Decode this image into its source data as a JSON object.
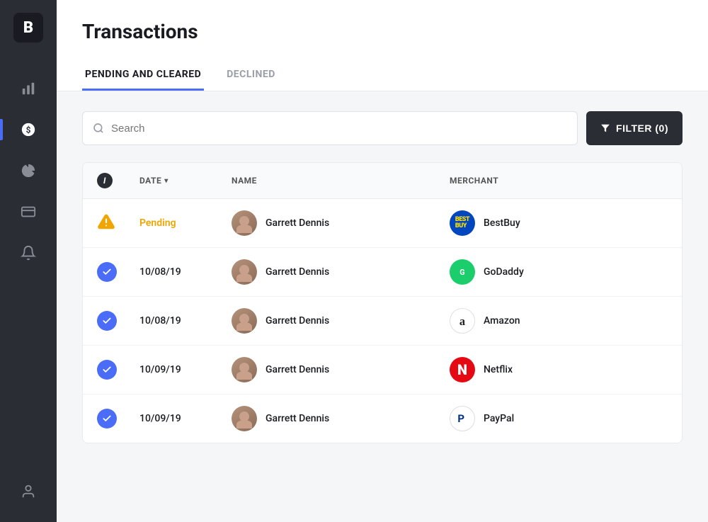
{
  "sidebar": {
    "logo": "B",
    "items": [
      {
        "id": "analytics",
        "icon": "chart-bar",
        "active": false
      },
      {
        "id": "transactions",
        "icon": "dollar-circle",
        "active": true
      },
      {
        "id": "pie-chart",
        "icon": "pie-chart",
        "active": false
      },
      {
        "id": "cards",
        "icon": "card",
        "active": false
      },
      {
        "id": "notifications",
        "icon": "bell",
        "active": false
      }
    ],
    "bottom_items": [
      {
        "id": "profile",
        "icon": "user",
        "active": false
      }
    ]
  },
  "page": {
    "title": "Transactions",
    "tabs": [
      {
        "id": "pending-cleared",
        "label": "PENDING AND CLEARED",
        "active": true
      },
      {
        "id": "declined",
        "label": "DECLINED",
        "active": false
      }
    ]
  },
  "search": {
    "placeholder": "Search",
    "value": ""
  },
  "filter_button": {
    "label": "FILTER (0)"
  },
  "table": {
    "headers": [
      {
        "id": "info",
        "label": ""
      },
      {
        "id": "date",
        "label": "DATE",
        "sortable": true
      },
      {
        "id": "name",
        "label": "NAME"
      },
      {
        "id": "merchant",
        "label": "MERCHANT"
      }
    ],
    "rows": [
      {
        "status": "pending",
        "status_icon": "warning",
        "date": "Pending",
        "name": "Garrett Dennis",
        "merchant_name": "BestBuy",
        "merchant_type": "bestbuy"
      },
      {
        "status": "cleared",
        "status_icon": "check",
        "date": "10/08/19",
        "name": "Garrett Dennis",
        "merchant_name": "GoDaddy",
        "merchant_type": "godaddy"
      },
      {
        "status": "cleared",
        "status_icon": "check",
        "date": "10/08/19",
        "name": "Garrett Dennis",
        "merchant_name": "Amazon",
        "merchant_type": "amazon"
      },
      {
        "status": "cleared",
        "status_icon": "check",
        "date": "10/09/19",
        "name": "Garrett Dennis",
        "merchant_name": "Netflix",
        "merchant_type": "netflix"
      },
      {
        "status": "cleared",
        "status_icon": "check",
        "date": "10/09/19",
        "name": "Garrett Dennis",
        "merchant_name": "PayPal",
        "merchant_type": "paypal"
      }
    ]
  },
  "colors": {
    "accent": "#4a6cf7",
    "sidebar_bg": "#2b2d35",
    "pending_color": "#f0a500"
  }
}
